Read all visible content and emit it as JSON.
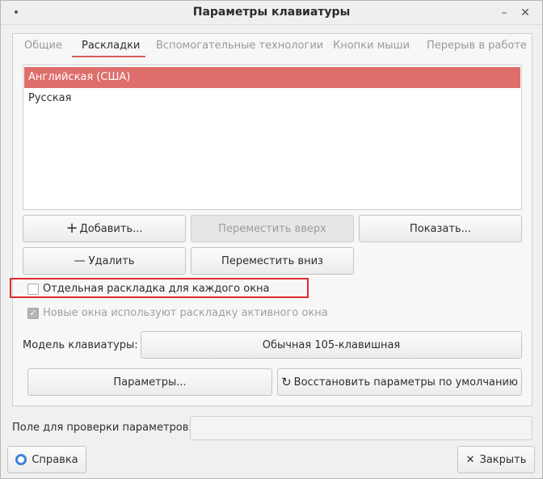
{
  "window": {
    "title": "Параметры клавиатуры",
    "menu_glyph": "•",
    "minimize_glyph": "–",
    "close_glyph": "✕"
  },
  "tabs": [
    {
      "label": "Общие",
      "active": false
    },
    {
      "label": "Раскладки",
      "active": true
    },
    {
      "label": "Вспомогательные технологии",
      "active": false
    },
    {
      "label": "Кнопки мыши",
      "active": false
    },
    {
      "label": "Перерыв в работе",
      "active": false
    }
  ],
  "layouts": {
    "items": [
      {
        "label": "Английская (США)",
        "selected": true
      },
      {
        "label": "Русская",
        "selected": false
      }
    ]
  },
  "buttons": {
    "add": {
      "label": "Добавить...",
      "icon": "plus-icon",
      "glyph": "+"
    },
    "move_up": {
      "label": "Переместить вверх",
      "enabled": false
    },
    "show": {
      "label": "Показать..."
    },
    "remove": {
      "label": "Удалить",
      "icon": "minus-icon",
      "glyph": "—"
    },
    "move_down": {
      "label": "Переместить вниз"
    },
    "options": {
      "label": "Параметры..."
    },
    "reset": {
      "label": "Восстановить параметры по умолчанию",
      "icon": "reset-icon",
      "glyph": "↻"
    },
    "help": {
      "label": "Справка",
      "icon": "help-lifebuoy-icon"
    },
    "close": {
      "label": "Закрыть",
      "icon": "close-icon",
      "glyph": "✕"
    }
  },
  "options": {
    "separate_layout": {
      "label": "Отдельная раскладка для каждого окна",
      "checked": false
    },
    "new_windows_active": {
      "label": "Новые окна используют раскладку активного окна",
      "checked": true,
      "enabled": false,
      "glyph": "✓"
    }
  },
  "keyboard_model": {
    "label": "Модель клавиатуры:",
    "value": "Обычная 105-клавишная"
  },
  "test_field": {
    "label": "Поле для проверки параметров:",
    "value": ""
  },
  "colors": {
    "selection": "#de6e6c",
    "tab_underline": "#d85b5b",
    "highlight_frame": "#de2c2c",
    "help_icon": "#3d84d8"
  }
}
